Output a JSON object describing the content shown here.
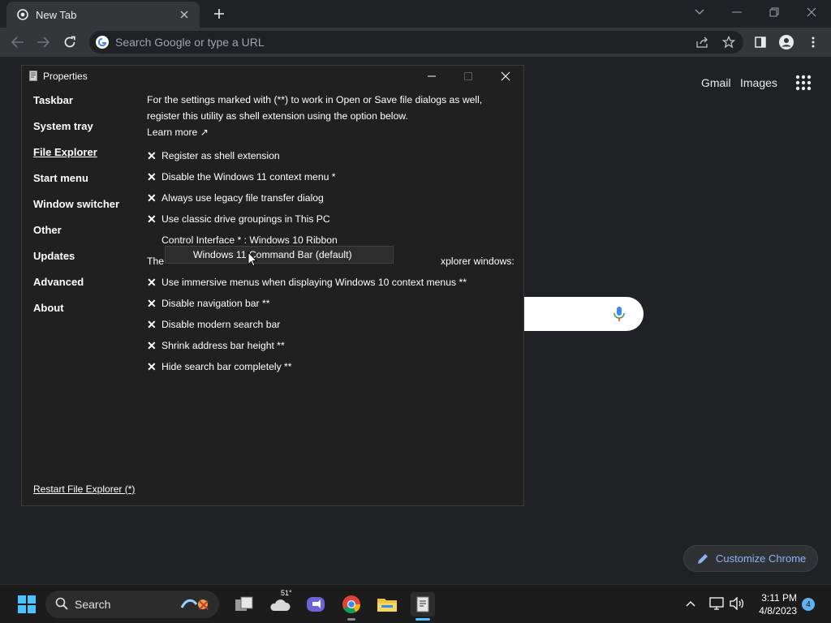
{
  "browser": {
    "tab_title": "New Tab",
    "omnibox_placeholder": "Search Google or type a URL",
    "ntp_links": {
      "gmail": "Gmail",
      "images": "Images"
    },
    "customize_label": "Customize Chrome"
  },
  "dialog": {
    "title": "Properties",
    "nav": [
      {
        "label": "Taskbar"
      },
      {
        "label": "System tray"
      },
      {
        "label": "File Explorer"
      },
      {
        "label": "Start menu"
      },
      {
        "label": "Window switcher"
      },
      {
        "label": "Other"
      },
      {
        "label": "Updates"
      },
      {
        "label": "Advanced"
      },
      {
        "label": "About"
      }
    ],
    "intro": "For the settings marked with (**) to work in Open or Save file dialogs as well, register this utility as shell extension using the option below.",
    "learn_more": "Learn more ↗",
    "options_top": [
      {
        "label": "Register as shell extension"
      },
      {
        "label": "Disable the Windows 11 context menu *"
      },
      {
        "label": "Always use legacy file transfer dialog"
      },
      {
        "label": "Use classic drive groupings in This PC"
      }
    ],
    "control_interface": "Control Interface * : Windows 10 Ribbon",
    "dropdown_option": "Windows 11 Command Bar (default)",
    "following_prefix": "The",
    "following_suffix": "xplorer windows:",
    "options_bottom": [
      {
        "label": "Use immersive menus when displaying Windows 10 context menus **"
      },
      {
        "label": "Disable navigation bar **"
      },
      {
        "label": "Disable modern search bar"
      },
      {
        "label": "Shrink address bar height **"
      },
      {
        "label": "Hide search bar completely **"
      }
    ],
    "restart_link": "Restart File Explorer (*)",
    "check_mark": "✕"
  },
  "taskbar": {
    "search_label": "Search",
    "weather_temp": "51°",
    "time": "3:11 PM",
    "date": "4/8/2023",
    "notification_count": "4"
  },
  "colors": {
    "chrome_dark": "#202124",
    "chrome_toolbar": "#35363a",
    "dialog_bg": "#202020",
    "accent_link": "#8ab4f8"
  }
}
